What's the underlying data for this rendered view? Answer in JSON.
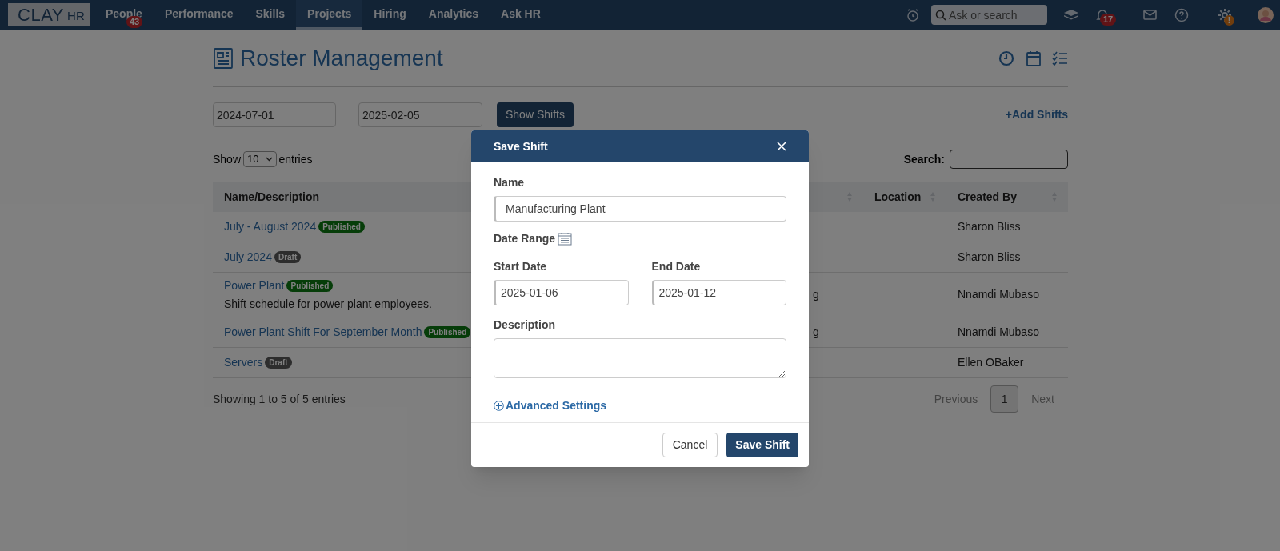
{
  "nav": {
    "logo": {
      "text": "CLAY",
      "suffix": "HR"
    },
    "items": [
      {
        "label": "People",
        "selected": false,
        "badge": "43"
      },
      {
        "label": "Performance",
        "selected": false
      },
      {
        "label": "Skills",
        "selected": false
      },
      {
        "label": "Projects",
        "selected": true
      },
      {
        "label": "Hiring",
        "selected": false
      },
      {
        "label": "Analytics",
        "selected": false
      },
      {
        "label": "Ask HR",
        "selected": false
      }
    ],
    "search": {
      "placeholder": "Ask or search"
    },
    "notifications_badge": "17",
    "settings_badge": "!"
  },
  "page": {
    "title": "Roster Management",
    "filters": {
      "start_date": "2024-07-01",
      "end_date": "2025-02-05",
      "show_button": "Show Shifts",
      "add_link": "+Add Shifts"
    },
    "length": {
      "label": "Show",
      "value": "10",
      "suffix": "entries"
    },
    "search_label": "Search:",
    "table": {
      "columns": [
        {
          "label": "Name/Description"
        },
        {},
        {
          "label": "Location"
        },
        {
          "label": "Created By"
        }
      ],
      "rows": [
        {
          "name": "July - August 2024",
          "status": {
            "label": "Published",
            "kind": "published"
          },
          "created_by": "Sharon Bliss"
        },
        {
          "name": "July 2024",
          "status": {
            "label": "Draft",
            "kind": "draft"
          },
          "created_by": "Sharon Bliss"
        },
        {
          "name": "Power Plant",
          "status": {
            "label": "Published",
            "kind": "published"
          },
          "description": "Shift schedule for power plant employees.",
          "column_2": "g",
          "created_by": "Nnamdi Mubaso"
        },
        {
          "name": "Power Plant Shift For September Month",
          "status": {
            "label": "Published",
            "kind": "published"
          },
          "column_2": "g",
          "created_by": "Nnamdi Mubaso"
        },
        {
          "name": "Servers",
          "status": {
            "label": "Draft",
            "kind": "draft"
          },
          "created_by": "Ellen OBaker"
        }
      ]
    },
    "info": "Showing 1 to 5 of 5 entries",
    "pagination": {
      "previous": "Previous",
      "pages": [
        {
          "label": "1",
          "selected": true
        }
      ],
      "next": "Next"
    }
  },
  "modal": {
    "title": "Save Shift",
    "name_label": "Name",
    "name_value": "Manufacturing Plant",
    "range_label": "Date Range",
    "start_label": "Start Date",
    "start_value": "2025-01-06",
    "end_label": "End Date",
    "end_value": "2025-01-12",
    "description_label": "Description",
    "advanced": "Advanced Settings",
    "cancel": "Cancel",
    "save": "Save Shift"
  }
}
